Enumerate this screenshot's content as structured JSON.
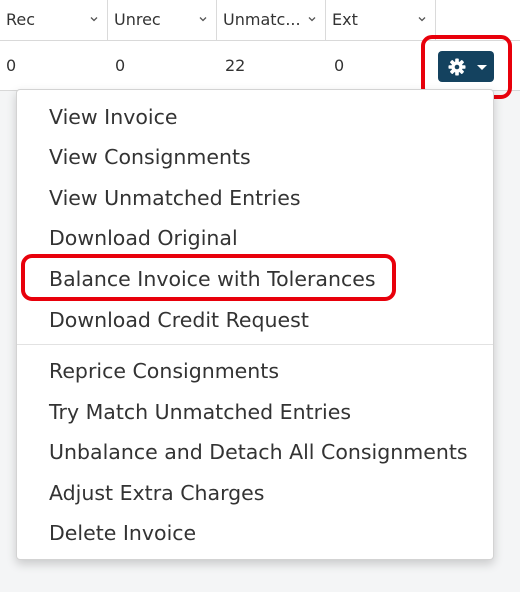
{
  "grid": {
    "columns": [
      "Rec",
      "Unrec",
      "Unmatc...",
      "Ext"
    ],
    "row": [
      "0",
      "0",
      "22",
      "0"
    ]
  },
  "actions_button": {
    "icon": "gear-icon",
    "color": "#14425f"
  },
  "highlight_color": "#e8000b",
  "menu": {
    "group1": [
      "View Invoice",
      "View Consignments",
      "View Unmatched Entries",
      "Download Original",
      "Balance Invoice with Tolerances",
      "Download Credit Request"
    ],
    "group2": [
      "Reprice Consignments",
      "Try Match Unmatched Entries",
      "Unbalance and Detach All Consignments",
      "Adjust Extra Charges",
      "Delete Invoice"
    ]
  }
}
